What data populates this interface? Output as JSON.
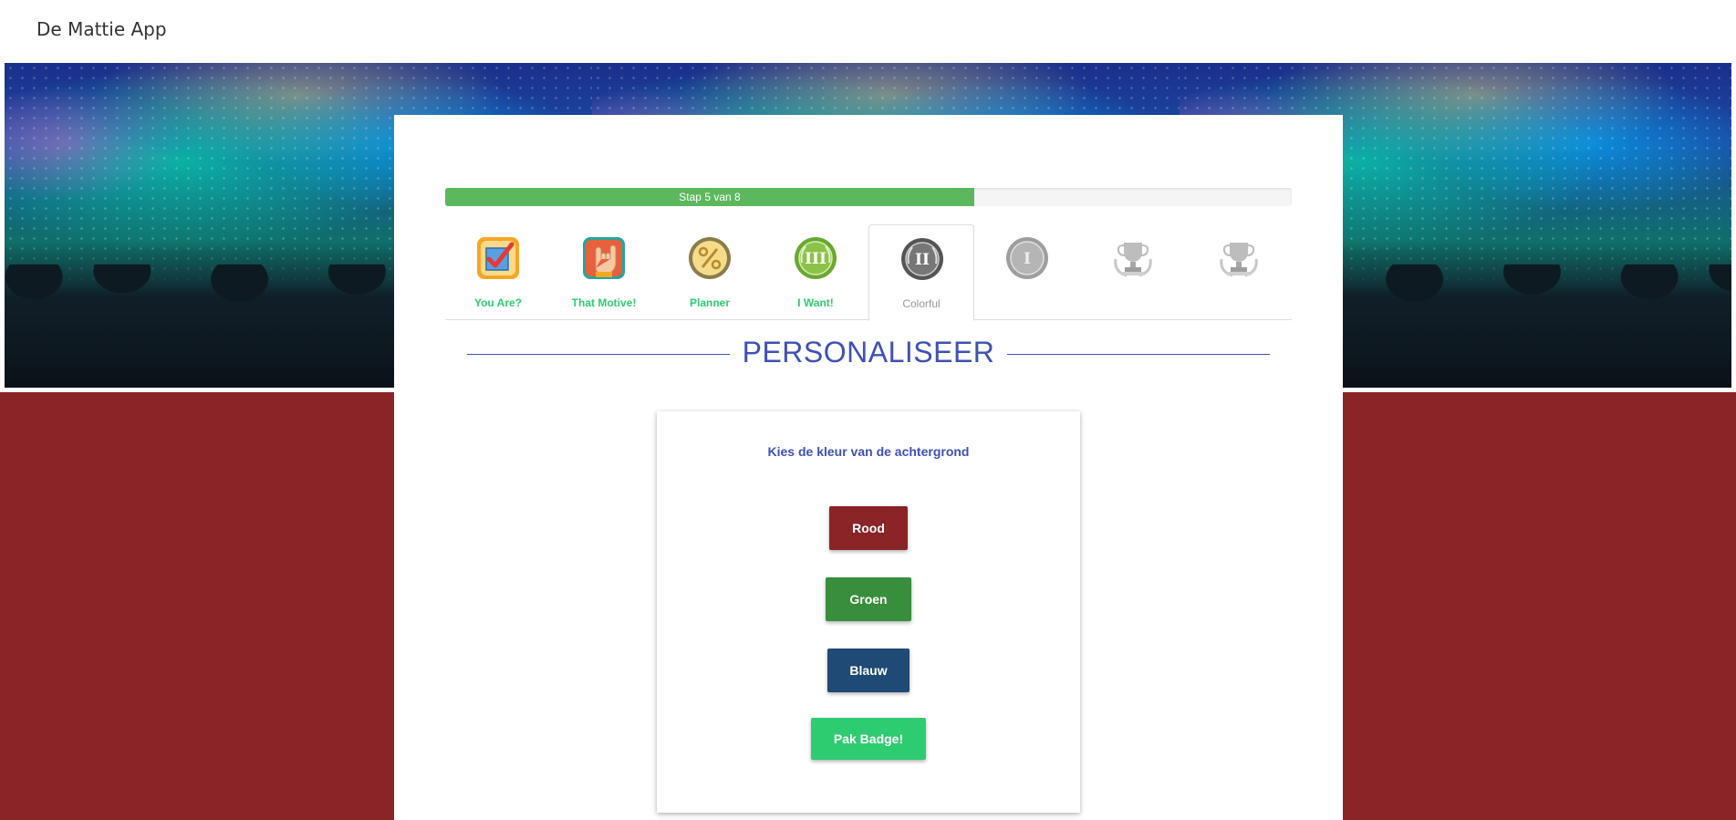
{
  "app": {
    "title": "De Mattie App"
  },
  "colors": {
    "background": "#8a2426",
    "progress": "#5cb85c",
    "accent": "#3f51b5",
    "tab_label": "#2ecc71",
    "rood": "#8a2426",
    "groen": "#388e3c",
    "blauw": "#1e4a75",
    "badge_button": "#2ecc71"
  },
  "progress": {
    "label": "Stap 5 van 8",
    "fraction": 0.625
  },
  "tabs": [
    {
      "label": "You Are?",
      "icon": "checkbox-icon",
      "state": "done"
    },
    {
      "label": "That Motive!",
      "icon": "rock-hand-icon",
      "state": "done"
    },
    {
      "label": "Planner",
      "icon": "percent-badge-icon",
      "state": "done"
    },
    {
      "label": "I Want!",
      "icon": "roman-three-medal-icon",
      "state": "done"
    },
    {
      "label": "Colorful",
      "icon": "roman-two-medal-icon",
      "state": "active"
    },
    {
      "label": "",
      "icon": "roman-one-medal-icon",
      "state": "locked"
    },
    {
      "label": "",
      "icon": "trophy-icon",
      "state": "locked"
    },
    {
      "label": "",
      "icon": "trophy-icon",
      "state": "locked"
    }
  ],
  "section": {
    "heading": "PERSONALISEER"
  },
  "panel": {
    "title": "Kies de kleur van de achtergrond",
    "buttons": {
      "rood": "Rood",
      "groen": "Groen",
      "blauw": "Blauw",
      "badge": "Pak Badge!"
    }
  }
}
